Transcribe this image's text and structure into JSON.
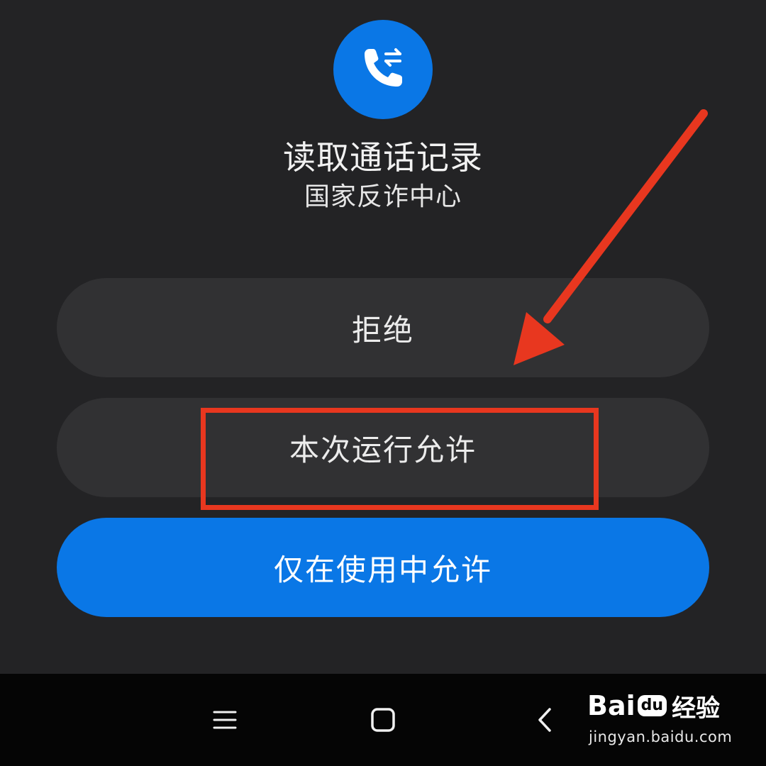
{
  "dialog": {
    "app_icon": "phone-call-log-icon",
    "title": "读取通话记录",
    "subtitle": "国家反诈中心"
  },
  "buttons": {
    "deny_label": "拒绝",
    "allow_once_label": "本次运行允许",
    "allow_while_using_label": "仅在使用中允许"
  },
  "navbar": {
    "menu_icon": "menu-icon",
    "home_icon": "home-icon",
    "back_icon": "back-icon"
  },
  "watermark": {
    "logo_text_1": "Bai",
    "logo_text_2": "du",
    "logo_text_3": "经验",
    "url": "jingyan.baidu.com"
  },
  "colors": {
    "background": "#232325",
    "button_secondary": "#313133",
    "button_primary": "#0a77e6",
    "annotation": "#e8371f"
  }
}
